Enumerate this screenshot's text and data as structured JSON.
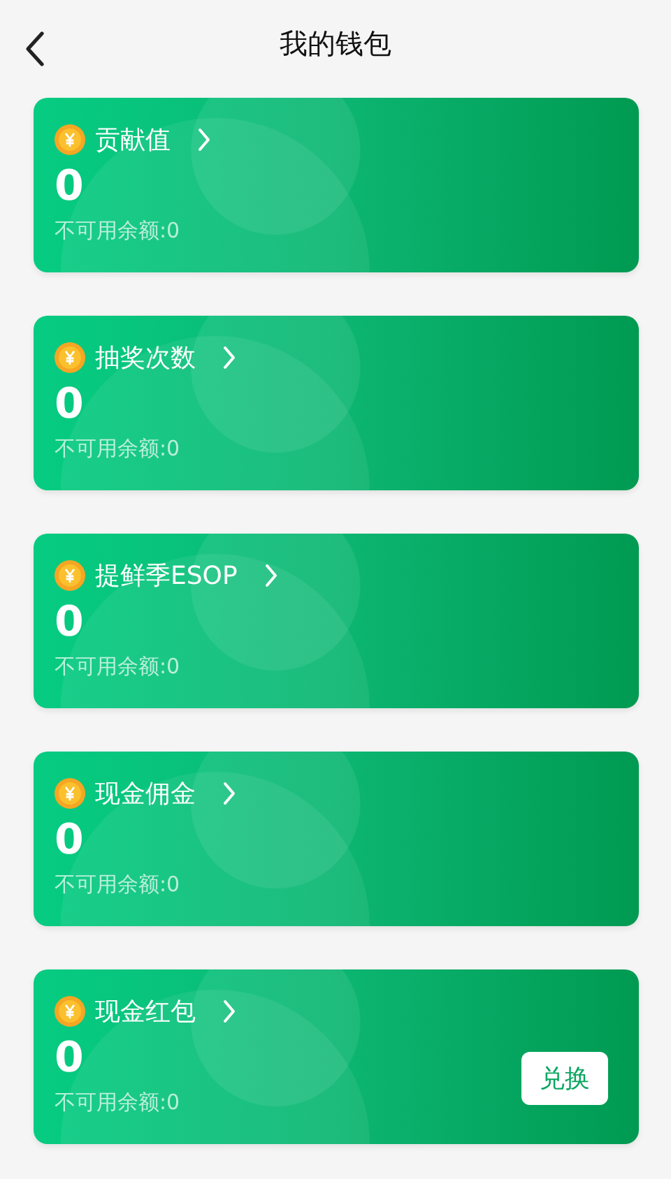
{
  "header": {
    "title": "我的钱包"
  },
  "cards": [
    {
      "name": "贡献值",
      "amount": "0",
      "unavailable": "不可用余额:0"
    },
    {
      "name": "抽奖次数",
      "amount": "0",
      "unavailable": "不可用余额:0"
    },
    {
      "name": "提鲜季ESOP",
      "amount": "0",
      "unavailable": "不可用余额:0"
    },
    {
      "name": "现金佣金",
      "amount": "0",
      "unavailable": "不可用余额:0"
    },
    {
      "name": "现金红包",
      "amount": "0",
      "unavailable": "不可用余额:0",
      "action": "兑换"
    }
  ]
}
